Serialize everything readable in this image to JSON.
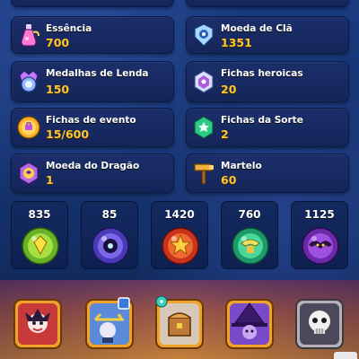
{
  "resources": [
    {
      "name": "Essência",
      "value": "700",
      "icon": "essence-potion-icon"
    },
    {
      "name": "Moeda de Clã",
      "value": "1351",
      "icon": "clan-coin-icon"
    },
    {
      "name": "Medalhas de Lenda",
      "value": "150",
      "icon": "legend-medal-icon"
    },
    {
      "name": "Fichas heroicas",
      "value": "20",
      "icon": "heroic-token-icon"
    },
    {
      "name": "Fichas de evento",
      "value": "15/600",
      "icon": "event-token-icon"
    },
    {
      "name": "Fichas da Sorte",
      "value": "2",
      "icon": "luck-token-icon"
    },
    {
      "name": "Moeda do Dragão",
      "value": "1",
      "icon": "dragon-coin-icon"
    },
    {
      "name": "Martelo",
      "value": "60",
      "icon": "hammer-icon"
    }
  ],
  "orbs": [
    {
      "value": "835",
      "icon": "yellow-orb-icon",
      "color": "#8fd13a"
    },
    {
      "value": "85",
      "icon": "purple-orb-icon",
      "color": "#6b4fd8"
    },
    {
      "value": "1420",
      "icon": "red-orb-icon",
      "color": "#e0442c"
    },
    {
      "value": "760",
      "icon": "green-orb-icon",
      "color": "#3fc48a"
    },
    {
      "value": "1125",
      "icon": "violet-orb-icon",
      "color": "#8a3ed0"
    }
  ],
  "hero_slots": [
    {
      "icon": "jester-hero-icon"
    },
    {
      "icon": "crossbow-hero-icon"
    },
    {
      "icon": "chest-hero-icon"
    },
    {
      "icon": "witch-hero-icon"
    },
    {
      "icon": "skull-hero-icon"
    }
  ],
  "colors": {
    "value_gold": "#ffc72a",
    "card_bg": "#1b2f6b",
    "frame_gold": "#f0a22a"
  }
}
